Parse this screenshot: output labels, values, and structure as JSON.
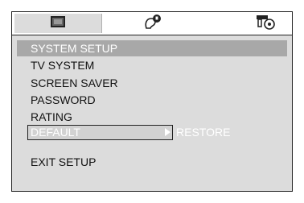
{
  "icon_tabs": [
    {
      "icon": "tv-screen-icon",
      "selected": true
    },
    {
      "icon": "lock-person-icon",
      "selected": false
    },
    {
      "icon": "speaker-disc-icon",
      "selected": false
    }
  ],
  "menu": {
    "header": "SYSTEM SETUP",
    "items": [
      {
        "label": "TV SYSTEM"
      },
      {
        "label": "SCREEN SAVER"
      },
      {
        "label": "PASSWORD"
      },
      {
        "label": "RATING"
      },
      {
        "label": "DEFAULT",
        "highlighted": true
      }
    ],
    "exit": "EXIT SETUP"
  },
  "submenu": {
    "option": "RESTORE"
  },
  "colors": {
    "frame_bg": "#dcdcdc",
    "header_bg": "#a8a8a8",
    "highlight_text": "#ffffff",
    "text": "#111111"
  }
}
